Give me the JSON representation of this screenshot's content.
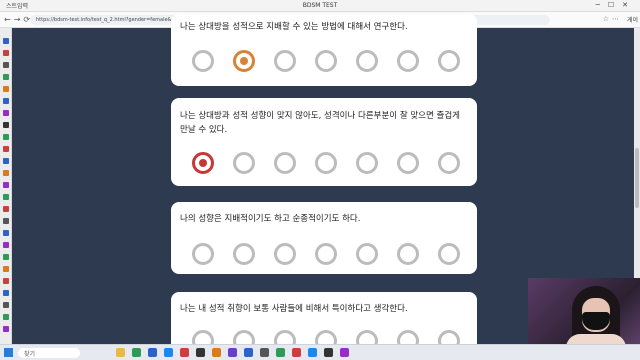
{
  "browser": {
    "tab_title": "스트입력",
    "window_title": "BDSM TEST",
    "url": "https://bdsm-test.info/test_q_2.html?gender=female&age=18&sexual=pan&consent=yes&cdom=16&sub=24",
    "profile": "게이"
  },
  "taskbar": {
    "search_placeholder": "찾기"
  },
  "questions": [
    {
      "text": "나는 상대방을 성적으로 지배할 수 있는 방법에 대해서 연구한다.",
      "selected_index": 1,
      "selected_color": "#d98432"
    },
    {
      "text": "나는 상대방과 성적 성향이 맞지 않아도, 성격이나 다른부분이 잘 맞으면 즐겁게 만날 수 있다.",
      "selected_index": 0,
      "selected_color": "#c63737"
    },
    {
      "text": "나의 성향은 지배적이기도 하고 순종적이기도 하다.",
      "selected_index": null,
      "selected_color": ""
    },
    {
      "text": "나는 내 성적 취향이 보통 사람들에 비해서 특이하다고 생각한다.",
      "selected_index": null,
      "selected_color": ""
    }
  ],
  "colors": {
    "page_background": "#2d3a4f",
    "unselected_ring": "#bcbcbc"
  }
}
